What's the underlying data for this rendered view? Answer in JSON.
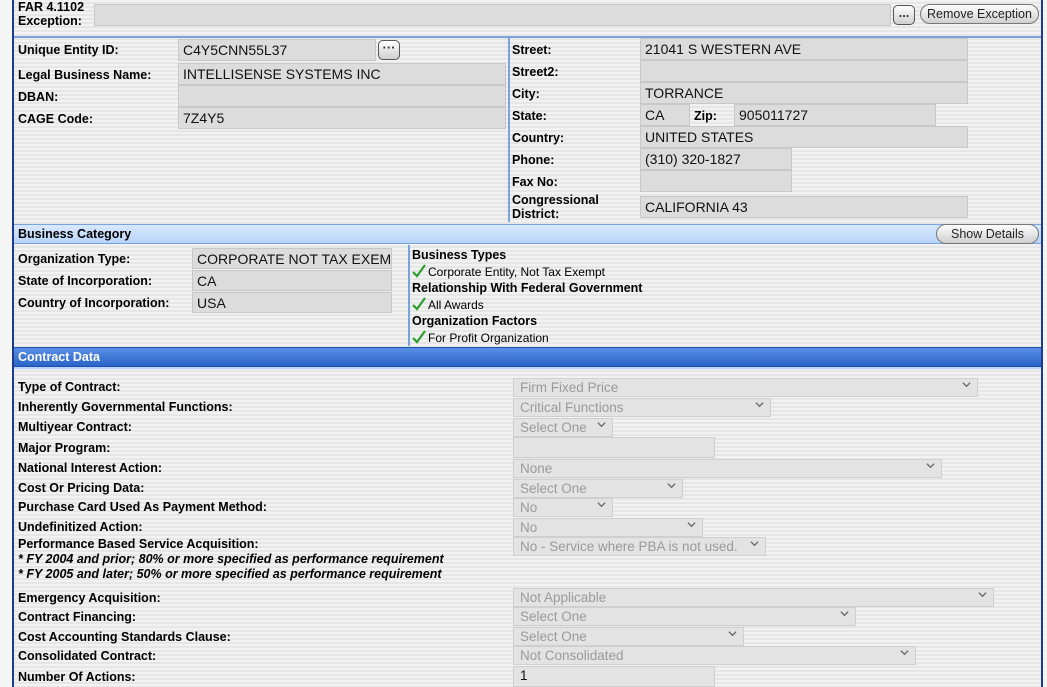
{
  "far_exception": {
    "label_line1": "FAR 4.1102",
    "label_line2": "Exception:",
    "value": "",
    "remove_label": "Remove Exception",
    "lookup_label": "..."
  },
  "vendor": {
    "uei_label": "Unique Entity ID:",
    "uei": "C4Y5CNN55L37",
    "legal_label": "Legal Business Name:",
    "legal": "INTELLISENSE SYSTEMS INC",
    "dban_label": "DBAN:",
    "dban": "",
    "cage_label": "CAGE Code:",
    "cage": "7Z4Y5",
    "street_label": "Street:",
    "street": "21041 S WESTERN AVE",
    "street2_label": "Street2:",
    "street2": "",
    "city_label": "City:",
    "city": "TORRANCE",
    "state_label": "State:",
    "state": "CA",
    "zip_label": "Zip:",
    "zip": "905011727",
    "country_label": "Country:",
    "country": "UNITED STATES",
    "phone_label": "Phone:",
    "phone": "(310) 320-1827",
    "fax_label": "Fax No:",
    "fax": "",
    "cong_label_1": "Congressional",
    "cong_label_2": "District:",
    "cong": "CALIFORNIA 43"
  },
  "business": {
    "title": "Business Category",
    "show_details": "Show Details",
    "org_type_label": "Organization Type:",
    "org_type": "CORPORATE NOT TAX EXEMPT",
    "state_inc_label": "State of Incorporation:",
    "state_inc": "CA",
    "country_inc_label": "Country of Incorporation:",
    "country_inc": "USA",
    "types_title": "Business Types",
    "types_item": "Corporate Entity, Not Tax Exempt",
    "rel_title": "Relationship With Federal Government",
    "rel_item": "All Awards",
    "factors_title": "Organization Factors",
    "factors_item": "For Profit Organization"
  },
  "contract": {
    "title": "Contract Data",
    "rows": [
      {
        "label": "Type of Contract:",
        "value": "Firm Fixed Price"
      },
      {
        "label": "Inherently Governmental Functions:",
        "value": "Critical Functions"
      },
      {
        "label": "Multiyear Contract:",
        "value": "Select One"
      },
      {
        "label": "Major Program:",
        "value": ""
      },
      {
        "label": "National Interest Action:",
        "value": "None"
      },
      {
        "label": "Cost Or Pricing Data:",
        "value": "Select One"
      },
      {
        "label": "Purchase Card Used As Payment Method:",
        "value": "No"
      },
      {
        "label": "Undefinitized Action:",
        "value": "No"
      },
      {
        "label": "Performance Based Service Acquisition:",
        "value": "No - Service where PBA is not used."
      },
      {
        "label": "Emergency Acquisition:",
        "value": "Not Applicable"
      },
      {
        "label": "Contract Financing:",
        "value": "Select One"
      },
      {
        "label": "Cost Accounting Standards Clause:",
        "value": "Select One"
      },
      {
        "label": "Consolidated Contract:",
        "value": "Not Consolidated"
      },
      {
        "label": "Number Of Actions:",
        "value": "1"
      }
    ],
    "pba_note_1": "* FY 2004 and prior; 80% or more specified as performance requirement",
    "pba_note_2": "* FY 2005 and later; 50% or more specified as performance requirement"
  },
  "colors": {
    "frame": "#1f3a93",
    "section": "#b8d4f8",
    "section_dark": "#2a64c8",
    "check": "#2e9e2e"
  }
}
